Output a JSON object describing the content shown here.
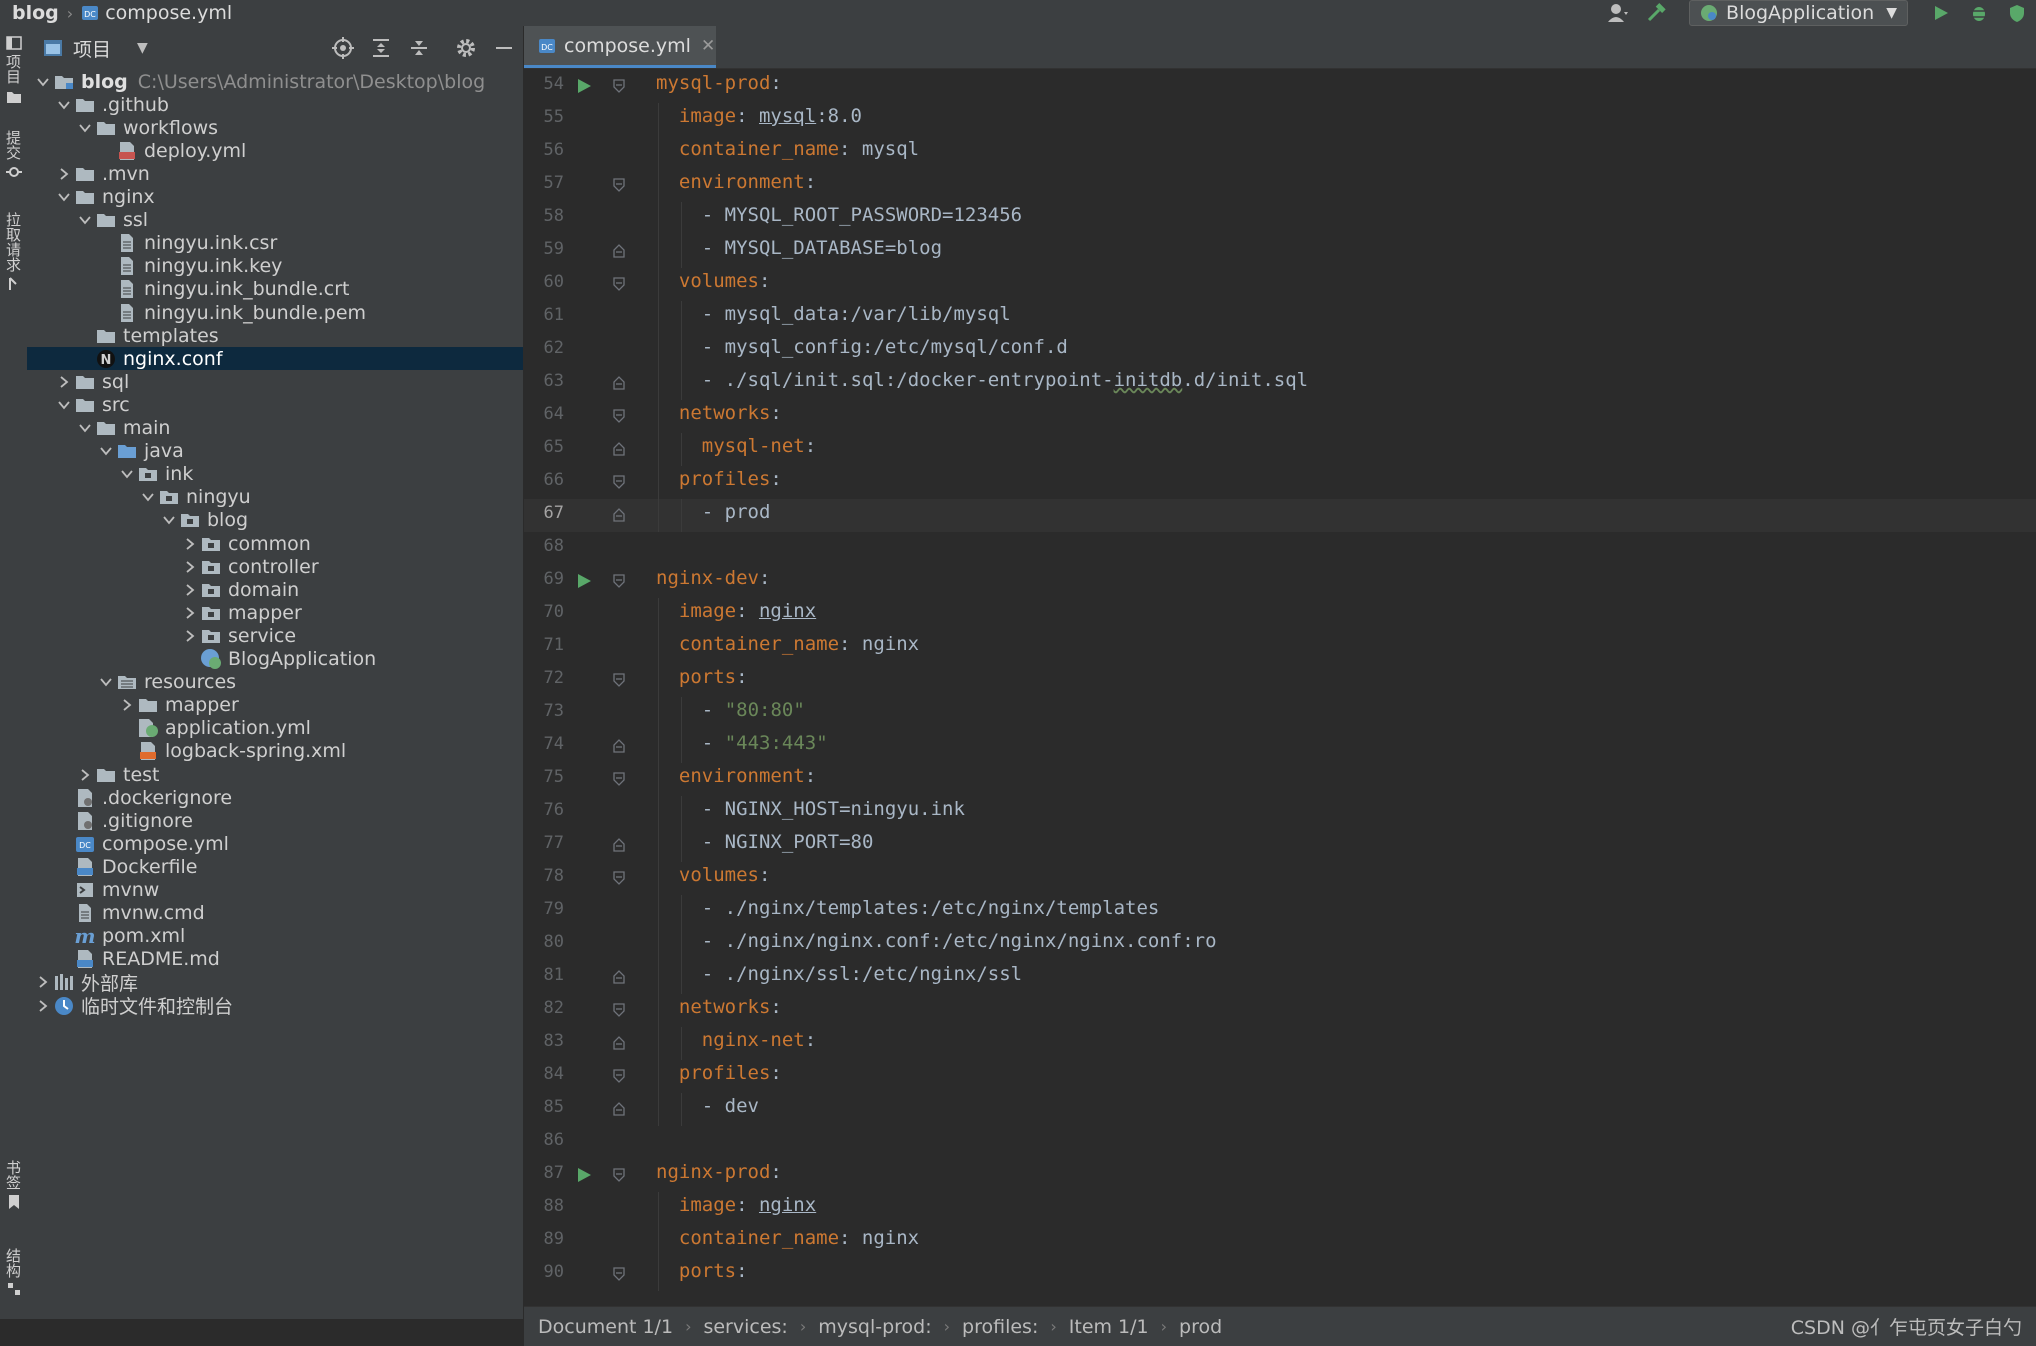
{
  "breadcrumb": {
    "project": "blog",
    "file": "compose.yml"
  },
  "run_config": {
    "name": "BlogApplication"
  },
  "left_strip": {
    "project_label": "项目",
    "commit_label": "提交",
    "pull_label": "拉取请求",
    "bookmarks_label": "书签",
    "structure_label": "结构"
  },
  "project_panel": {
    "title": "项目",
    "tree": [
      {
        "label": "blog",
        "path": "C:\\Users\\Administrator\\Desktop\\blog",
        "depth": 0,
        "state": "open",
        "icon": "module-folder-icon"
      },
      {
        "label": ".github",
        "depth": 1,
        "state": "open",
        "icon": "folder-icon"
      },
      {
        "label": "workflows",
        "depth": 2,
        "state": "open",
        "icon": "folder-icon"
      },
      {
        "label": "deploy.yml",
        "depth": 3,
        "state": "leaf",
        "icon": "yaml-file-icon"
      },
      {
        "label": ".mvn",
        "depth": 1,
        "state": "closed",
        "icon": "folder-icon"
      },
      {
        "label": "nginx",
        "depth": 1,
        "state": "open",
        "icon": "folder-icon"
      },
      {
        "label": "ssl",
        "depth": 2,
        "state": "open",
        "icon": "folder-icon"
      },
      {
        "label": "ningyu.ink.csr",
        "depth": 3,
        "state": "leaf",
        "icon": "text-file-icon"
      },
      {
        "label": "ningyu.ink.key",
        "depth": 3,
        "state": "leaf",
        "icon": "text-file-icon"
      },
      {
        "label": "ningyu.ink_bundle.crt",
        "depth": 3,
        "state": "leaf",
        "icon": "text-file-icon"
      },
      {
        "label": "ningyu.ink_bundle.pem",
        "depth": 3,
        "state": "leaf",
        "icon": "text-file-icon"
      },
      {
        "label": "templates",
        "depth": 2,
        "state": "leaf",
        "icon": "folder-icon"
      },
      {
        "label": "nginx.conf",
        "depth": 2,
        "state": "leaf",
        "icon": "nginx-file-icon",
        "selected": true
      },
      {
        "label": "sql",
        "depth": 1,
        "state": "closed",
        "icon": "folder-icon"
      },
      {
        "label": "src",
        "depth": 1,
        "state": "open",
        "icon": "folder-icon"
      },
      {
        "label": "main",
        "depth": 2,
        "state": "open",
        "icon": "folder-icon"
      },
      {
        "label": "java",
        "depth": 3,
        "state": "open",
        "icon": "source-folder-icon"
      },
      {
        "label": "ink",
        "depth": 4,
        "state": "open",
        "icon": "package-icon"
      },
      {
        "label": "ningyu",
        "depth": 5,
        "state": "open",
        "icon": "package-icon"
      },
      {
        "label": "blog",
        "depth": 6,
        "state": "open",
        "icon": "package-icon"
      },
      {
        "label": "common",
        "depth": 7,
        "state": "closed",
        "icon": "package-icon"
      },
      {
        "label": "controller",
        "depth": 7,
        "state": "closed",
        "icon": "package-icon"
      },
      {
        "label": "domain",
        "depth": 7,
        "state": "closed",
        "icon": "package-icon"
      },
      {
        "label": "mapper",
        "depth": 7,
        "state": "closed",
        "icon": "package-icon"
      },
      {
        "label": "service",
        "depth": 7,
        "state": "closed",
        "icon": "package-icon"
      },
      {
        "label": "BlogApplication",
        "depth": 7,
        "state": "leaf",
        "icon": "spring-class-icon"
      },
      {
        "label": "resources",
        "depth": 3,
        "state": "open",
        "icon": "resources-folder-icon"
      },
      {
        "label": "mapper",
        "depth": 4,
        "state": "closed",
        "icon": "folder-icon"
      },
      {
        "label": "application.yml",
        "depth": 4,
        "state": "leaf",
        "icon": "spring-yaml-icon"
      },
      {
        "label": "logback-spring.xml",
        "depth": 4,
        "state": "leaf",
        "icon": "xml-file-icon"
      },
      {
        "label": "test",
        "depth": 2,
        "state": "closed",
        "icon": "folder-icon"
      },
      {
        "label": ".dockerignore",
        "depth": 1,
        "state": "leaf",
        "icon": "ignore-file-icon"
      },
      {
        "label": ".gitignore",
        "depth": 1,
        "state": "leaf",
        "icon": "ignore-file-icon"
      },
      {
        "label": "compose.yml",
        "depth": 1,
        "state": "leaf",
        "icon": "compose-file-icon"
      },
      {
        "label": "Dockerfile",
        "depth": 1,
        "state": "leaf",
        "icon": "docker-file-icon"
      },
      {
        "label": "mvnw",
        "depth": 1,
        "state": "leaf",
        "icon": "shell-file-icon"
      },
      {
        "label": "mvnw.cmd",
        "depth": 1,
        "state": "leaf",
        "icon": "text-file-icon"
      },
      {
        "label": "pom.xml",
        "depth": 1,
        "state": "leaf",
        "icon": "maven-file-icon"
      },
      {
        "label": "README.md",
        "depth": 1,
        "state": "leaf",
        "icon": "markdown-file-icon"
      },
      {
        "label": "外部库",
        "depth": 0,
        "state": "closed",
        "icon": "library-icon"
      },
      {
        "label": "临时文件和控制台",
        "depth": 0,
        "state": "closed",
        "icon": "scratch-icon"
      }
    ]
  },
  "editor": {
    "tab": {
      "label": "compose.yml"
    },
    "current_line": 67,
    "lines": [
      {
        "n": 54,
        "indent": 0,
        "run": true,
        "fold": "open",
        "segs": [
          [
            "k",
            "mysql-prod"
          ],
          [
            "p",
            ":"
          ]
        ]
      },
      {
        "n": 55,
        "indent": 1,
        "segs": [
          [
            "k",
            "image"
          ],
          [
            "p",
            ": "
          ],
          [
            "u",
            "mysql"
          ],
          [
            "p",
            ":8.0"
          ]
        ]
      },
      {
        "n": 56,
        "indent": 1,
        "segs": [
          [
            "k",
            "container_name"
          ],
          [
            "p",
            ": mysql"
          ]
        ]
      },
      {
        "n": 57,
        "indent": 1,
        "fold": "open",
        "segs": [
          [
            "k",
            "environment"
          ],
          [
            "p",
            ":"
          ]
        ]
      },
      {
        "n": 58,
        "indent": 2,
        "segs": [
          [
            "p",
            "- MYSQL_ROOT_PASSWORD=123456"
          ]
        ]
      },
      {
        "n": 59,
        "indent": 2,
        "fold": "close",
        "segs": [
          [
            "p",
            "- MYSQL_DATABASE=blog"
          ]
        ]
      },
      {
        "n": 60,
        "indent": 1,
        "fold": "open",
        "segs": [
          [
            "k",
            "volumes"
          ],
          [
            "p",
            ":"
          ]
        ]
      },
      {
        "n": 61,
        "indent": 2,
        "segs": [
          [
            "p",
            "- mysql_data:/var/lib/mysql"
          ]
        ]
      },
      {
        "n": 62,
        "indent": 2,
        "segs": [
          [
            "p",
            "- mysql_config:/etc/mysql/conf.d"
          ]
        ]
      },
      {
        "n": 63,
        "indent": 2,
        "fold": "close",
        "segs": [
          [
            "p",
            "- ./sql/init.sql:/docker-entrypoint-"
          ],
          [
            "w",
            "initdb"
          ],
          [
            "p",
            ".d/init.sql"
          ]
        ]
      },
      {
        "n": 64,
        "indent": 1,
        "fold": "open",
        "segs": [
          [
            "k",
            "networks"
          ],
          [
            "p",
            ":"
          ]
        ]
      },
      {
        "n": 65,
        "indent": 2,
        "fold": "close",
        "segs": [
          [
            "k",
            "mysql-net"
          ],
          [
            "p",
            ":"
          ]
        ]
      },
      {
        "n": 66,
        "indent": 1,
        "fold": "open",
        "segs": [
          [
            "k",
            "profiles"
          ],
          [
            "p",
            ":"
          ]
        ]
      },
      {
        "n": 67,
        "indent": 2,
        "fold": "close",
        "segs": [
          [
            "p",
            "- prod"
          ]
        ]
      },
      {
        "n": 68,
        "indent": 0,
        "segs": []
      },
      {
        "n": 69,
        "indent": 0,
        "run": true,
        "fold": "open",
        "segs": [
          [
            "k",
            "nginx-dev"
          ],
          [
            "p",
            ":"
          ]
        ]
      },
      {
        "n": 70,
        "indent": 1,
        "segs": [
          [
            "k",
            "image"
          ],
          [
            "p",
            ": "
          ],
          [
            "u",
            "nginx"
          ]
        ]
      },
      {
        "n": 71,
        "indent": 1,
        "segs": [
          [
            "k",
            "container_name"
          ],
          [
            "p",
            ": nginx"
          ]
        ]
      },
      {
        "n": 72,
        "indent": 1,
        "fold": "open",
        "segs": [
          [
            "k",
            "ports"
          ],
          [
            "p",
            ":"
          ]
        ]
      },
      {
        "n": 73,
        "indent": 2,
        "segs": [
          [
            "p",
            "- "
          ],
          [
            "s",
            "\"80:80\""
          ]
        ]
      },
      {
        "n": 74,
        "indent": 2,
        "fold": "close",
        "segs": [
          [
            "p",
            "- "
          ],
          [
            "s",
            "\"443:443\""
          ]
        ]
      },
      {
        "n": 75,
        "indent": 1,
        "fold": "open",
        "segs": [
          [
            "k",
            "environment"
          ],
          [
            "p",
            ":"
          ]
        ]
      },
      {
        "n": 76,
        "indent": 2,
        "segs": [
          [
            "p",
            "- NGINX_HOST=ningyu.ink"
          ]
        ]
      },
      {
        "n": 77,
        "indent": 2,
        "fold": "close",
        "segs": [
          [
            "p",
            "- NGINX_PORT=80"
          ]
        ]
      },
      {
        "n": 78,
        "indent": 1,
        "fold": "open",
        "segs": [
          [
            "k",
            "volumes"
          ],
          [
            "p",
            ":"
          ]
        ]
      },
      {
        "n": 79,
        "indent": 2,
        "segs": [
          [
            "p",
            "- ./nginx/templates:/etc/nginx/templates"
          ]
        ]
      },
      {
        "n": 80,
        "indent": 2,
        "segs": [
          [
            "p",
            "- ./nginx/nginx.conf:/etc/nginx/nginx.conf:ro"
          ]
        ]
      },
      {
        "n": 81,
        "indent": 2,
        "fold": "close",
        "segs": [
          [
            "p",
            "- ./nginx/ssl:/etc/nginx/ssl"
          ]
        ]
      },
      {
        "n": 82,
        "indent": 1,
        "fold": "open",
        "segs": [
          [
            "k",
            "networks"
          ],
          [
            "p",
            ":"
          ]
        ]
      },
      {
        "n": 83,
        "indent": 2,
        "fold": "close",
        "segs": [
          [
            "k",
            "nginx-net"
          ],
          [
            "p",
            ":"
          ]
        ]
      },
      {
        "n": 84,
        "indent": 1,
        "fold": "open",
        "segs": [
          [
            "k",
            "profiles"
          ],
          [
            "p",
            ":"
          ]
        ]
      },
      {
        "n": 85,
        "indent": 2,
        "fold": "close",
        "segs": [
          [
            "p",
            "- dev"
          ]
        ]
      },
      {
        "n": 86,
        "indent": 0,
        "segs": []
      },
      {
        "n": 87,
        "indent": 0,
        "run": true,
        "fold": "open",
        "segs": [
          [
            "k",
            "nginx-prod"
          ],
          [
            "p",
            ":"
          ]
        ]
      },
      {
        "n": 88,
        "indent": 1,
        "segs": [
          [
            "k",
            "image"
          ],
          [
            "p",
            ": "
          ],
          [
            "u",
            "nginx"
          ]
        ]
      },
      {
        "n": 89,
        "indent": 1,
        "segs": [
          [
            "k",
            "container_name"
          ],
          [
            "p",
            ": nginx"
          ]
        ]
      },
      {
        "n": 90,
        "indent": 1,
        "fold": "open",
        "segs": [
          [
            "k",
            "ports"
          ],
          [
            "p",
            ":"
          ]
        ]
      }
    ]
  },
  "status": {
    "breadcrumbs": [
      "Document 1/1",
      "services:",
      "mysql-prod:",
      "profiles:",
      "Item 1/1",
      "prod"
    ],
    "watermark": "CSDN @亻乍屯页女子白勺"
  },
  "colors": {
    "keyword": "#cc7832",
    "string": "#6a8759",
    "plain": "#a9b7c6",
    "selection": "#0d293e",
    "accent": "#4a88c7",
    "run": "#59a869"
  }
}
